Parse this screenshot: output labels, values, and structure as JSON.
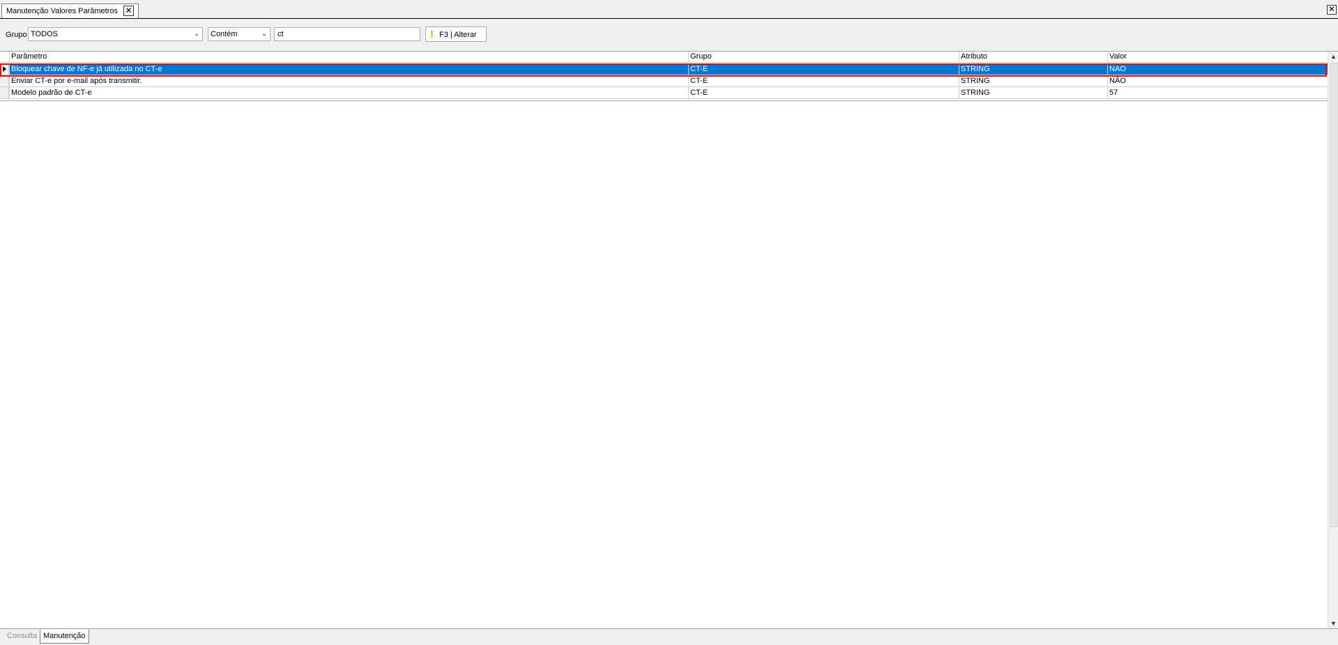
{
  "window": {
    "tab_title": "Manutenção Valores Parâmetros",
    "close_label": "✕"
  },
  "filter": {
    "grupo_label": "Grupo",
    "grupo_value": "TODOS",
    "operator_value": "Contém",
    "search_value": "ct",
    "alterar_label": "F3 | Alterar"
  },
  "grid": {
    "columns": [
      "Parâmetro",
      "Grupo",
      "Atributo",
      "Valor"
    ],
    "rows": [
      {
        "parametro": "Bloquear chave de NF-e já utilizada no CT-e",
        "grupo": "CT-E",
        "atributo": "STRING",
        "valor": "NAO"
      },
      {
        "parametro": "Enviar CT-e por e-mail após transmitir.",
        "grupo": "CT-E",
        "atributo": "STRING",
        "valor": "NÃO"
      },
      {
        "parametro": "Modelo padrão de CT-e",
        "grupo": "CT-E",
        "atributo": "STRING",
        "valor": "57"
      }
    ],
    "selected_row": 0
  },
  "bottom_tabs": [
    "Consulta",
    "Manutenção"
  ],
  "colors": {
    "selection": "#0078d7",
    "highlight_outline": "#e01010",
    "warning_icon": "#e8a000"
  },
  "icons": [
    "close-icon",
    "chevron-down-icon",
    "warning-icon",
    "row-indicator-icon",
    "scroll-up-icon",
    "scroll-down-icon"
  ]
}
